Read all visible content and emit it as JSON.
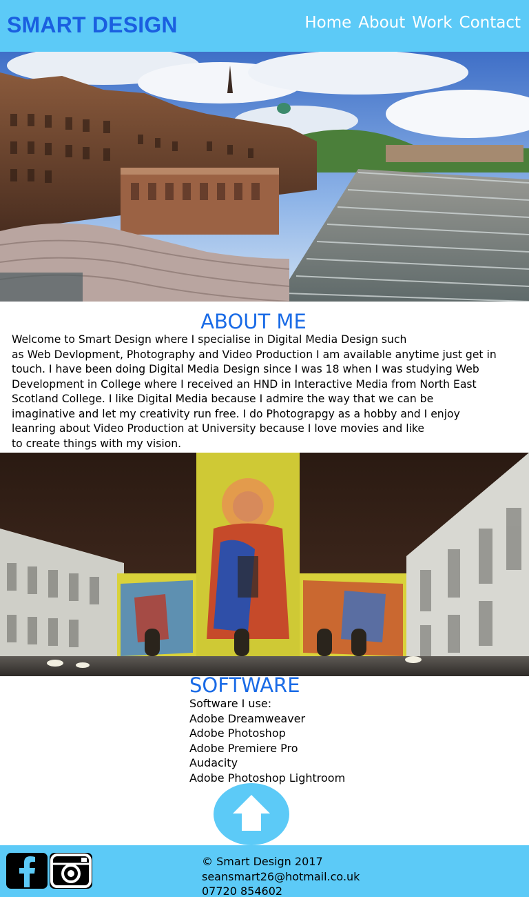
{
  "header": {
    "logo": "SMART DESIGN",
    "nav": [
      "Home",
      "About",
      "Work",
      "Contact"
    ]
  },
  "about": {
    "title": "ABOUT ME",
    "lines": [
      "Welcome to Smart Design where I specialise in Digital Media Design such",
      "as Web Devlopment, Photography and Video Production I am available anytime just get in",
      "touch. I have been doing Digital Media Design since I was 18 when I was studying Web",
      " Development in College where I received an HND in Interactive Media from North East",
      " Scotland College. I like Digital Media because I admire the way that we can be",
      "imaginative and let my creativity run free. I do Photograpgy as a hobby and I enjoy",
      " leanring about Video Production at University because I love movies and like",
      " to create things with my vision."
    ]
  },
  "software": {
    "title": "SOFTWARE",
    "intro": "Software I use:",
    "items": [
      "Adobe Dreamweaver",
      "Adobe Photoshop",
      "Adobe Premiere Pro",
      "Audacity",
      "Adobe Photoshop Lightroom"
    ]
  },
  "footer": {
    "copyright": "© Smart Design 2017",
    "email": "seansmart26@hotmail.co.uk",
    "phone": "07720 854602"
  },
  "icons": {
    "back_to_top": "up-arrow-icon",
    "facebook": "facebook-icon",
    "instagram": "instagram-icon"
  },
  "colors": {
    "header_bg": "#5ccaf7",
    "logo": "#1a5fe0",
    "heading": "#1a6be6",
    "nav_text": "#ffffff"
  }
}
